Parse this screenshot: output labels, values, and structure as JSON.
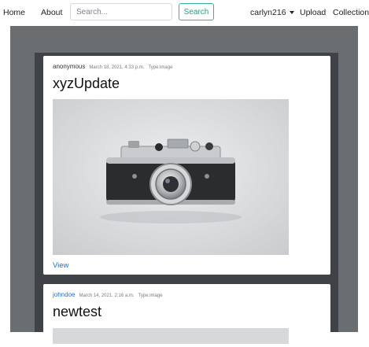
{
  "nav": {
    "home": "Home",
    "about": "About",
    "search_placeholder": "Search...",
    "search_button": "Search",
    "username": "carlyn216",
    "upload": "Upload",
    "collections": "Collections"
  },
  "posts": [
    {
      "author": "anonymous",
      "date": "March 18, 2021, 4:33 p.m.",
      "type": "Type:image",
      "title": "xyzUpdate",
      "view_label": "View"
    },
    {
      "author": "johndoe",
      "date": "March 14, 2021, 2:16 a.m.",
      "type": "Type:image",
      "title": "newtest"
    }
  ],
  "colors": {
    "accent_link": "#1f6fd0",
    "search_button": "#2fb79a",
    "backdrop": "#6b6e71",
    "lane": "#3f4347"
  }
}
